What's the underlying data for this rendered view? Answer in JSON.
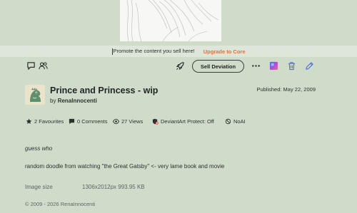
{
  "promo": {
    "text": "Promote the content you sell here!",
    "upgrade_label": "Upgrade to Core"
  },
  "toolbar": {
    "sell_label": "Sell Deviation",
    "icons": [
      "comment-icon",
      "watchers-icon",
      "rocket-icon",
      "more-icon",
      "gallery-icon",
      "delete-icon",
      "edit-icon"
    ]
  },
  "deviation": {
    "title": "Prince and Princess - wip",
    "by_prefix": "by",
    "author": "RenaInnocenti",
    "published": "Published: May 22, 2009"
  },
  "stats": {
    "favourites": "2 Favourites",
    "comments": "0 Comments",
    "views": "27 Views",
    "protect": "DeviantArt Protect: Off",
    "noai": "NoAI"
  },
  "description": {
    "italic": "guess who",
    "text": "random doodle from watching \"the Great Gatsby\" <- very lame book and movie"
  },
  "details": {
    "image_size_label": "Image size",
    "image_size_value": "1306x2012px 993.95 KB"
  },
  "footer": {
    "copyright": "© 2009 - 2026 RenaInnocenti"
  },
  "colors": {
    "background": "#d0dcca",
    "promo_strip": "#dde6d8",
    "upgrade_accent": "#e8703b",
    "edit_icon": "#4a6ee0",
    "delete_icon": "#4a6ee0"
  }
}
